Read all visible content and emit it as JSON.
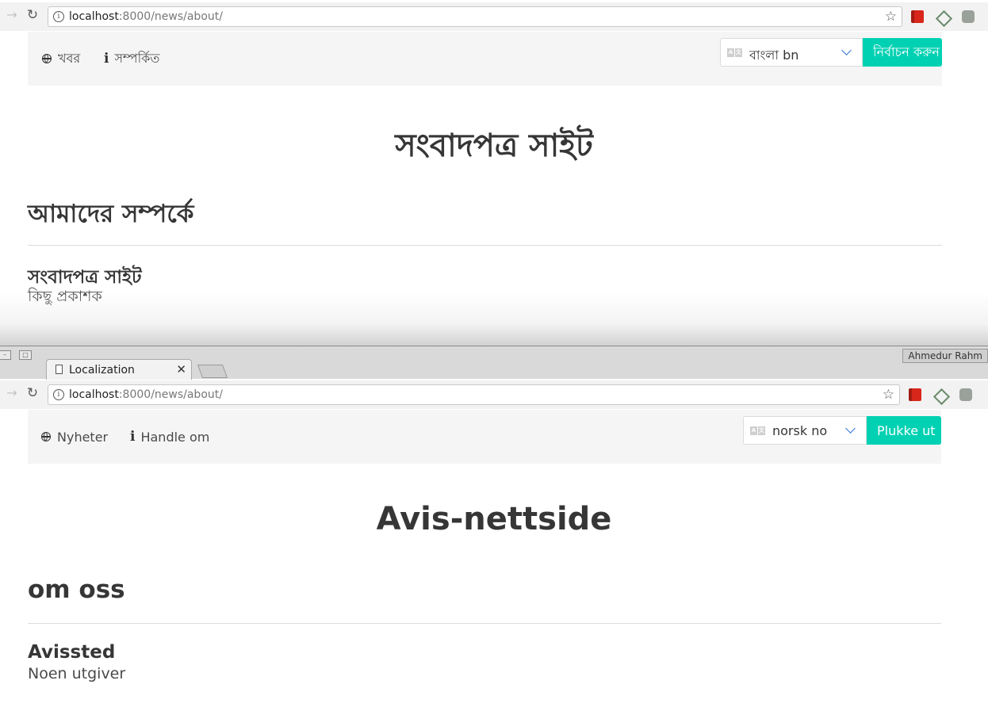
{
  "top_browser": {
    "url_host": "localhost",
    "url_rest": ":8000/news/about/",
    "nav": {
      "news_label": "খবর",
      "about_label": "সম্পর্কিত",
      "language_value": "বাংলা bn",
      "submit_label": "নির্বাচন করুন"
    },
    "site_title": "সংবাদপত্র সাইট",
    "about_heading": "আমাদের সম্পর্কে",
    "org_name": "সংবাদপত্র সাইট",
    "org_subtitle": "কিছু প্রকাশক"
  },
  "bottom_browser": {
    "profile_name": "Ahmedur Rahm",
    "tab_title": "Localization",
    "url_host": "localhost",
    "url_rest": ":8000/news/about/",
    "nav": {
      "news_label": "Nyheter",
      "about_label": "Handle om",
      "language_value": "norsk no",
      "submit_label": "Plukke ut"
    },
    "site_title": "Avis-nettside",
    "about_heading": "om oss",
    "org_name": "Avissted",
    "org_subtitle": "Noen utgiver"
  },
  "icons": [
    "forward-arrow-icon",
    "reload-icon",
    "info-icon",
    "star-icon",
    "globe-icon",
    "translate-icon",
    "chevron-down-icon",
    "close-icon",
    "document-icon"
  ],
  "colors": {
    "accent": "#00d1b2",
    "nav_background": "#f5f5f5",
    "select_chevron": "#3273dc"
  }
}
